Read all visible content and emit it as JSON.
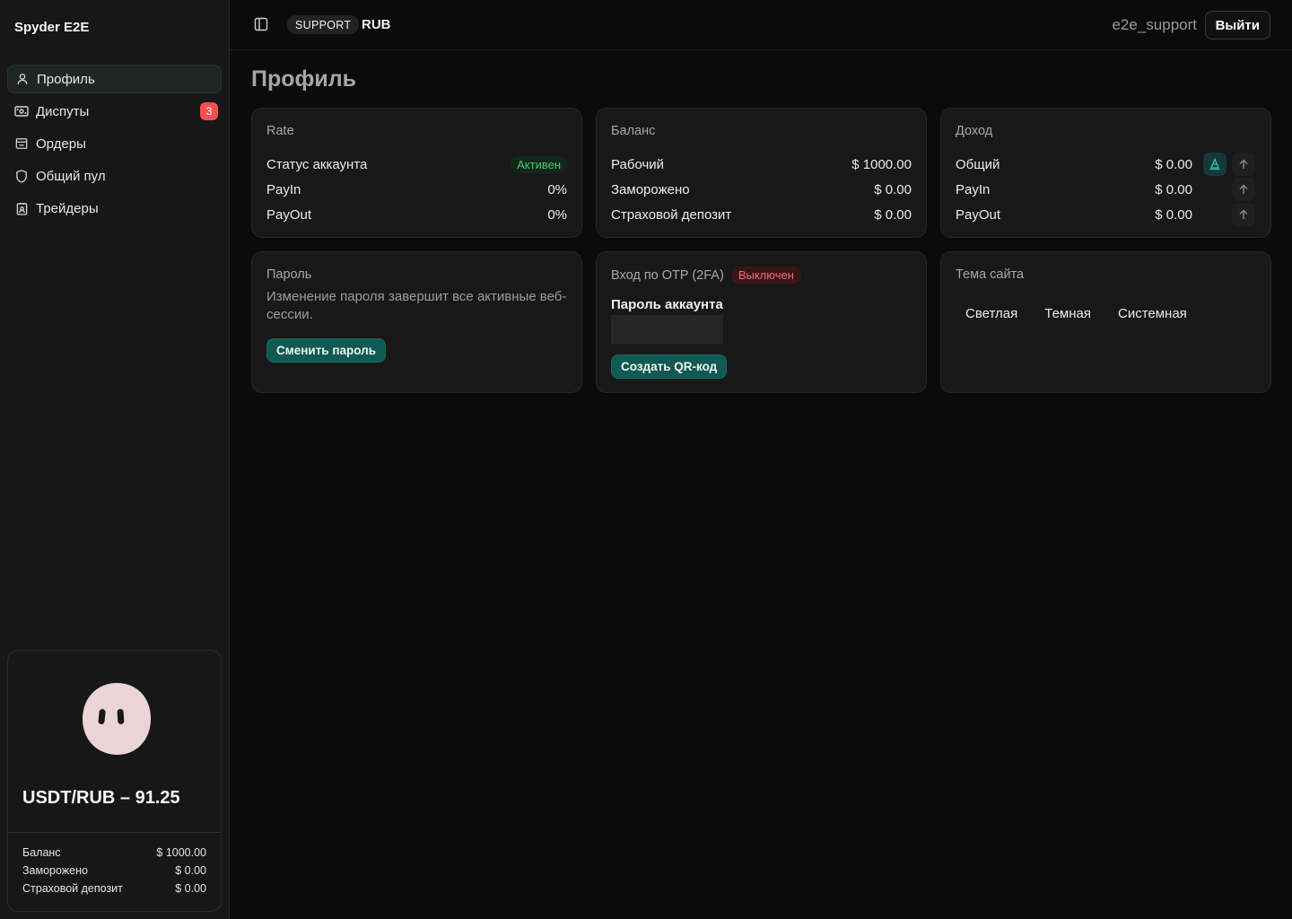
{
  "app": {
    "brand": "Spyder E2E"
  },
  "sidebar": {
    "items": [
      {
        "label": "Профиль",
        "icon": "user-icon",
        "active": true
      },
      {
        "label": "Диспуты",
        "icon": "ticket-icon",
        "badge": "3"
      },
      {
        "label": "Ордеры",
        "icon": "orders-icon"
      },
      {
        "label": "Общий пул",
        "icon": "shield-icon"
      },
      {
        "label": "Трейдеры",
        "icon": "traders-icon"
      }
    ],
    "rate_card": {
      "title": "USDT/RUB – 91.25",
      "rows": [
        {
          "label": "Баланс",
          "value": "$ 1000.00"
        },
        {
          "label": "Заморожено",
          "value": "$ 0.00"
        },
        {
          "label": "Страховой депозит",
          "value": "$ 0.00"
        }
      ]
    }
  },
  "header": {
    "role": "SUPPORT",
    "currency": "RUB",
    "username": "e2e_support",
    "logout_label": "Выйти"
  },
  "page": {
    "title": "Профиль"
  },
  "rate": {
    "title": "Rate",
    "status_label": "Статус аккаунта",
    "status_value": "Активен",
    "payin_label": "PayIn",
    "payin_value": "0%",
    "payout_label": "PayOut",
    "payout_value": "0%"
  },
  "balance": {
    "title": "Баланс",
    "rows": [
      {
        "label": "Рабочий",
        "value": "$ 1000.00"
      },
      {
        "label": "Заморожено",
        "value": "$ 0.00"
      },
      {
        "label": "Страховой депозит",
        "value": "$ 0.00"
      }
    ]
  },
  "income": {
    "title": "Доход",
    "rows": [
      {
        "label": "Общий",
        "value": "$ 0.00"
      },
      {
        "label": "PayIn",
        "value": "$ 0.00"
      },
      {
        "label": "PayOut",
        "value": "$ 0.00"
      }
    ]
  },
  "password": {
    "title": "Пароль",
    "description": "Изменение пароля завершит все активные веб-сессии.",
    "button": "Сменить пароль"
  },
  "otp": {
    "title": "Вход по OTP (2FA)",
    "status": "Выключен",
    "field_label": "Пароль аккаунта",
    "button": "Создать QR-код"
  },
  "theme": {
    "title": "Тема сайта",
    "options": [
      "Светлая",
      "Темная",
      "Системная"
    ]
  },
  "colors": {
    "accent": "#0f5a53",
    "success": "#3ccf74",
    "danger": "#f26d6d",
    "badge": "#f05252"
  }
}
